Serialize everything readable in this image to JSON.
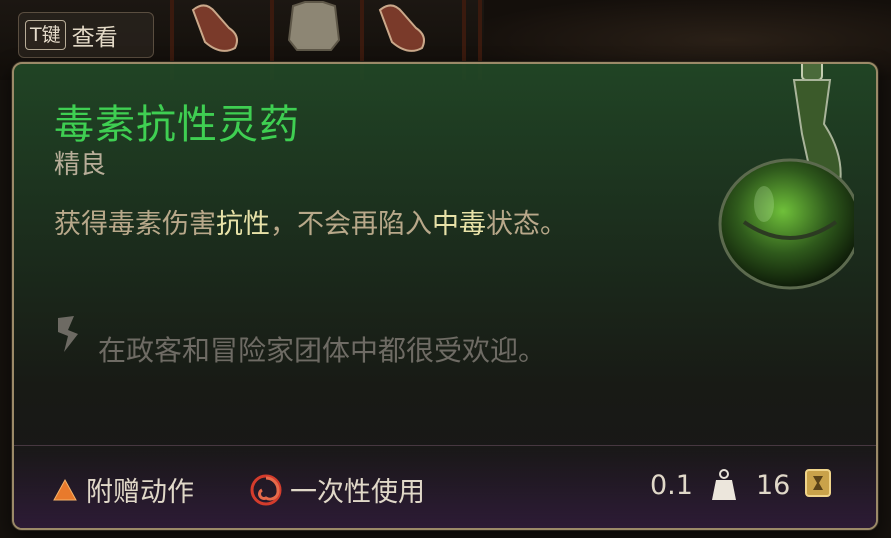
{
  "hint": {
    "key": "T键",
    "label": "查看"
  },
  "item": {
    "name": "毒素抗性灵药",
    "rarity": "精良",
    "description": {
      "p1": "获得毒素伤害",
      "h1": "抗性",
      "p2": "，不会再陷入",
      "h2": "中毒",
      "p3": "状态。"
    },
    "flavor": "在政客和冒险家团体中都很受欢迎。"
  },
  "footer": {
    "action": "附赠动作",
    "usage": "一次性使用",
    "weight": "0.1",
    "price": "16"
  },
  "icons": {
    "action": "triangle-icon",
    "usage": "swirl-icon",
    "weight": "weight-icon",
    "price": "gold-coin-icon",
    "flavor": "quill-icon",
    "potion": "potion-bottle-icon"
  },
  "colors": {
    "title": "#3fcf52",
    "highlight": "#e8e2a8",
    "panel_border": "#9b8a68",
    "action_triangle": "#e87a2c",
    "usage_swirl": "#d43c2c"
  }
}
